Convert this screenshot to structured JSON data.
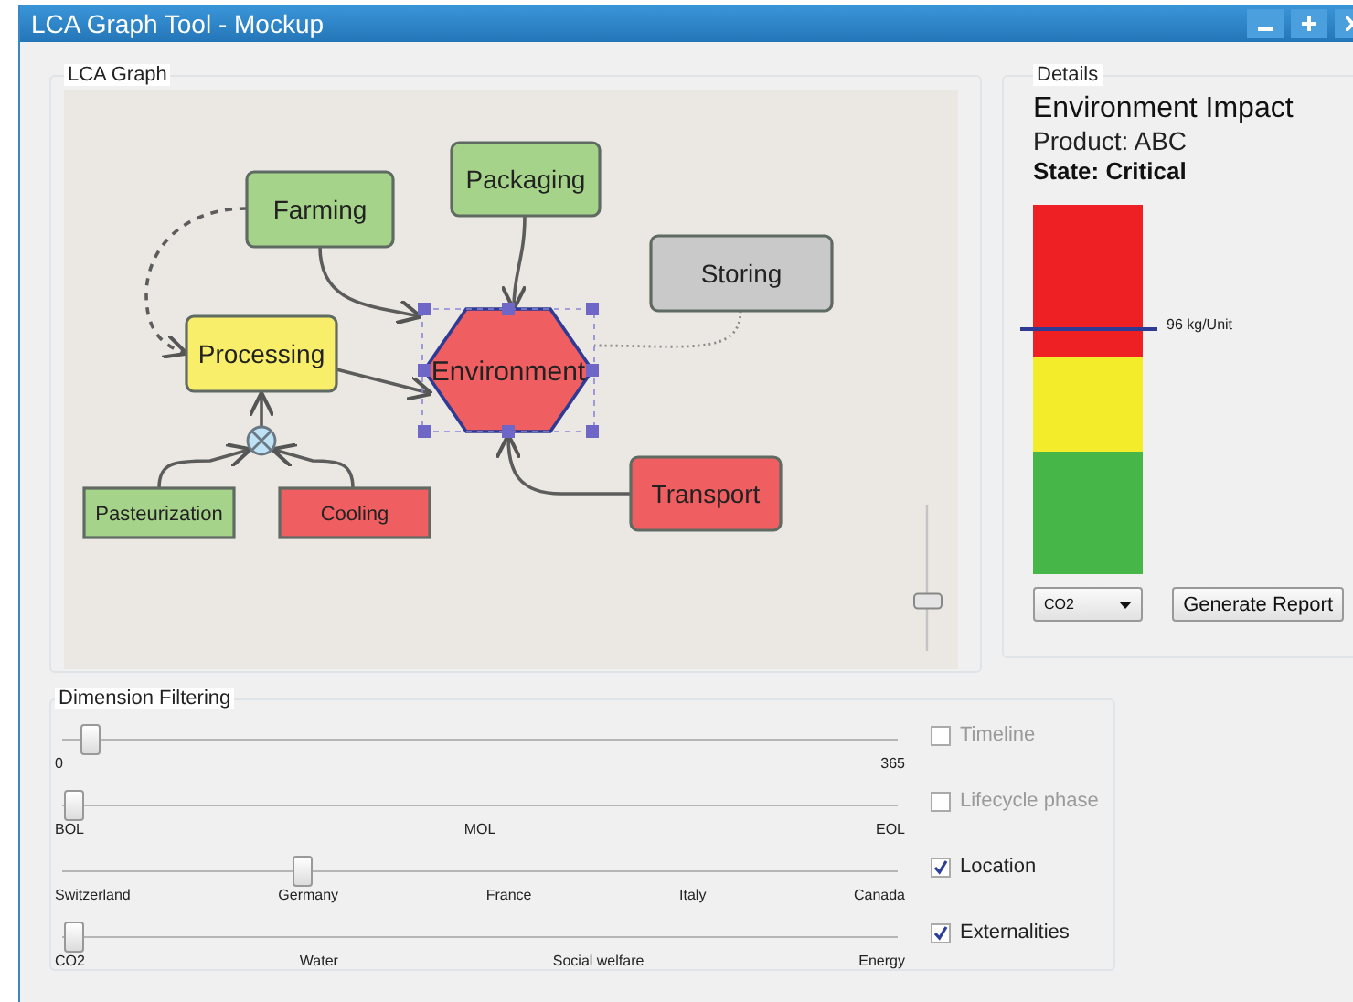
{
  "window": {
    "title": "LCA Graph Tool - Mockup"
  },
  "graph": {
    "legend": "LCA Graph",
    "nodes": [
      {
        "label": "Farming",
        "kind": "process",
        "color": "#a6d38a",
        "selected": false
      },
      {
        "label": "Packaging",
        "kind": "process",
        "color": "#a6d38a",
        "selected": false
      },
      {
        "label": "Storing",
        "kind": "process",
        "color": "#c9c9c9",
        "selected": false
      },
      {
        "label": "Processing",
        "kind": "process",
        "color": "#f8ee6a",
        "selected": false
      },
      {
        "label": "Environment",
        "kind": "impact",
        "color": "#ef5f61",
        "selected": true
      },
      {
        "label": "Transport",
        "kind": "process",
        "color": "#ef5f61",
        "selected": false
      },
      {
        "label": "Pasteurization",
        "kind": "input",
        "color": "#a6d38a",
        "selected": false
      },
      {
        "label": "Cooling",
        "kind": "input",
        "color": "#ef5f61",
        "selected": false
      }
    ],
    "zoom": {
      "level": 0.34
    }
  },
  "details": {
    "legend": "Details",
    "title": "Environment Impact",
    "product": "Product: ABC",
    "state": "State: Critical",
    "meter": {
      "bands": [
        {
          "color": "#ee2024"
        },
        {
          "color": "#f3ec2a"
        },
        {
          "color": "#46b649"
        }
      ],
      "level": 0.67,
      "reading": "96 kg/Unit"
    },
    "dropdown": {
      "value": "CO2"
    },
    "buttons": [
      "Generate Report"
    ]
  },
  "filters": {
    "legend": "Dimension Filtering",
    "rows": [
      {
        "ticks": [
          "0",
          "365"
        ],
        "level": 0.02,
        "label": "Timeline",
        "checked": false
      },
      {
        "ticks": [
          "BOL",
          "MOL",
          "EOL"
        ],
        "level": 0.0,
        "label": "Lifecycle phase",
        "checked": false
      },
      {
        "ticks": [
          "Switzerland",
          "Germany",
          "France",
          "Italy",
          "Canada"
        ],
        "level": 0.28,
        "label": "Location",
        "checked": true
      },
      {
        "ticks": [
          "CO2",
          "Water",
          "Social welfare",
          "Energy"
        ],
        "level": 0.0,
        "label": "Externalities",
        "checked": true
      }
    ]
  }
}
